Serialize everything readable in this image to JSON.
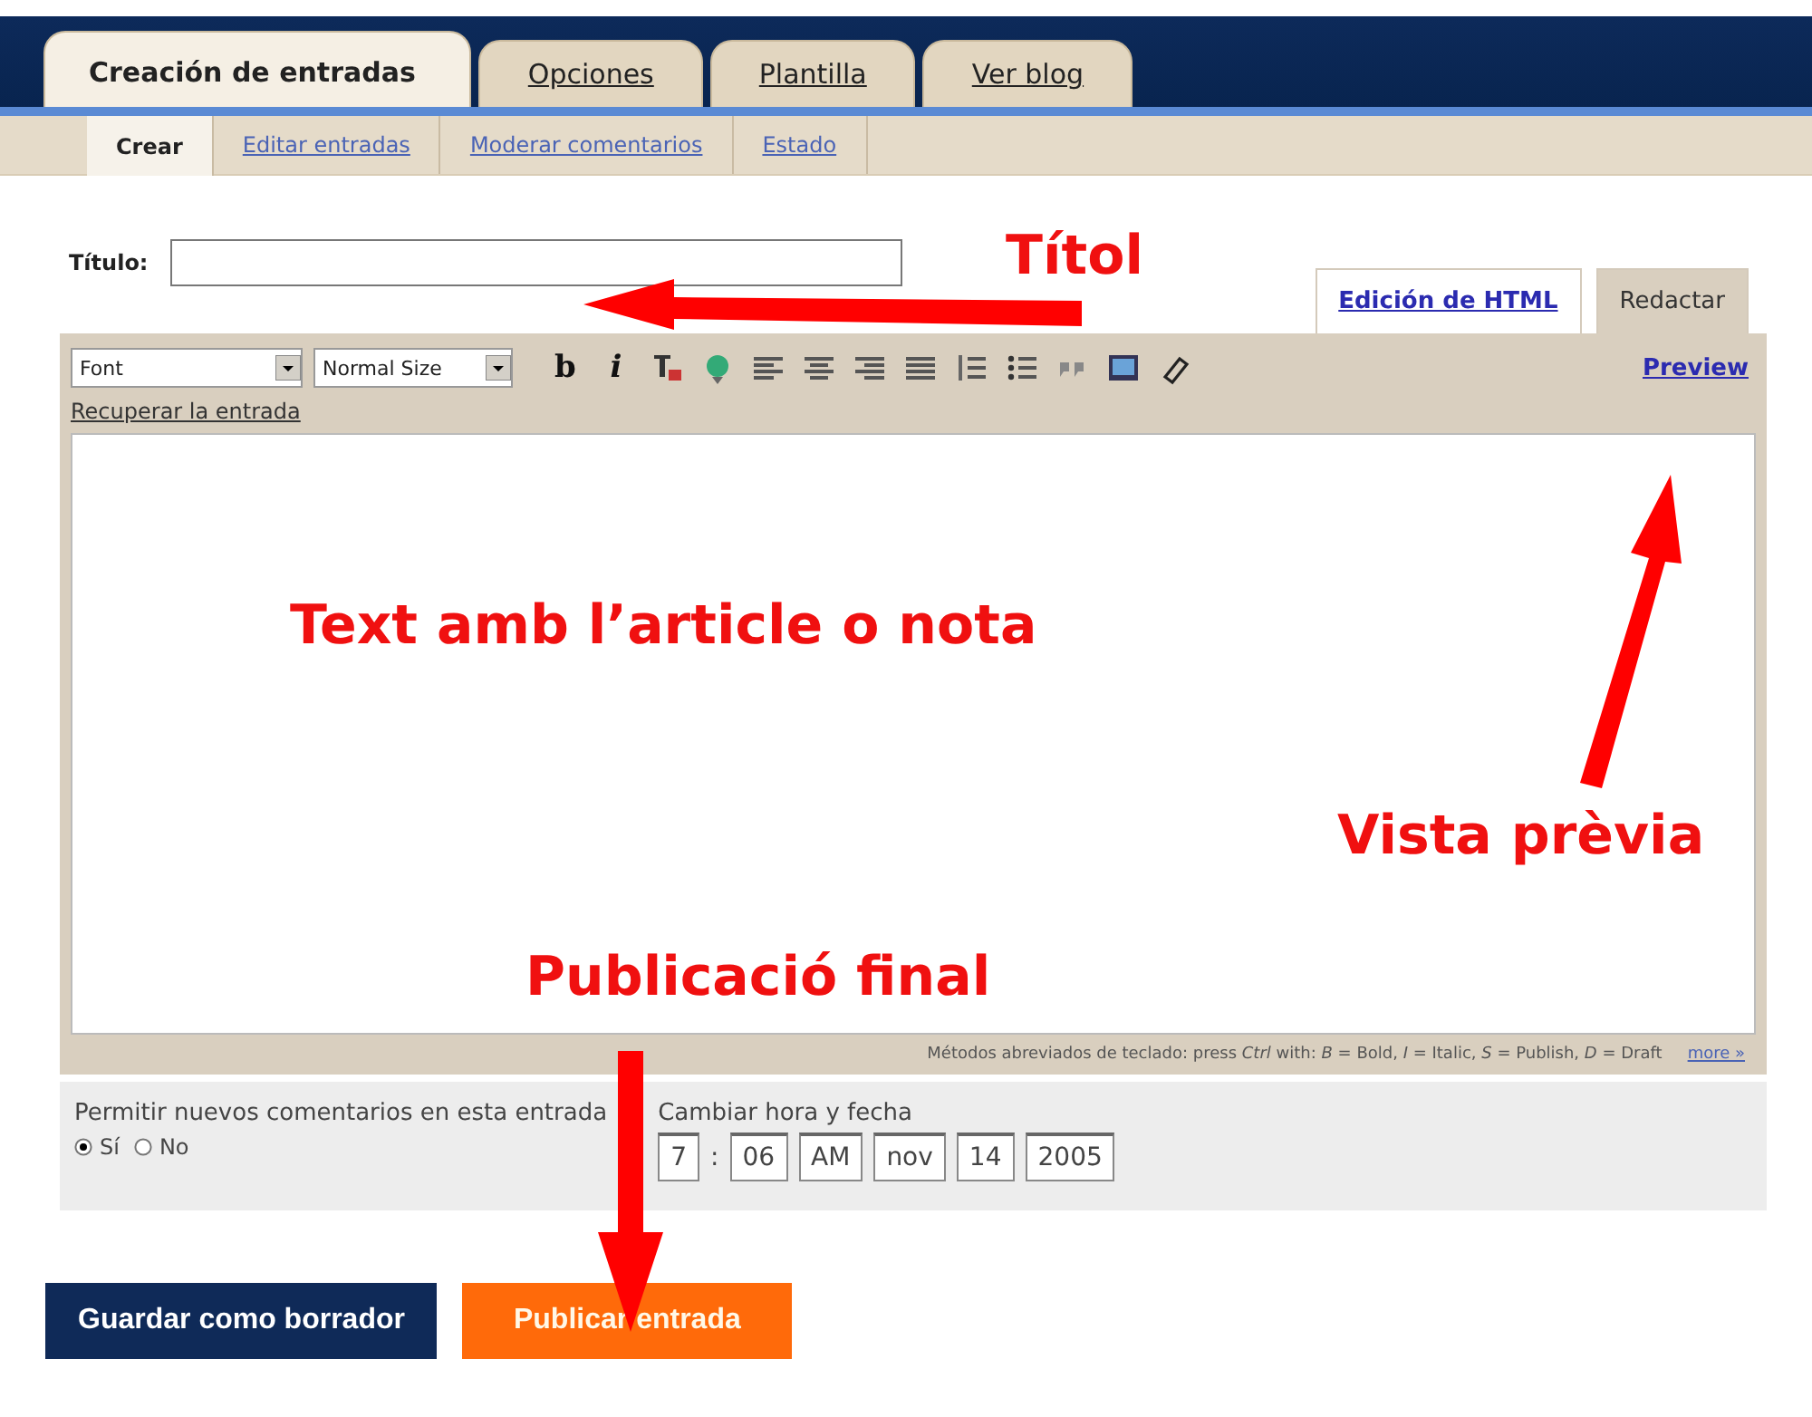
{
  "tabs": [
    {
      "label": "Creación de entradas",
      "selected": true
    },
    {
      "label": "Opciones",
      "selected": false
    },
    {
      "label": "Plantilla",
      "selected": false
    },
    {
      "label": "Ver blog",
      "selected": false
    }
  ],
  "subtabs": [
    {
      "label": "Crear",
      "selected": true
    },
    {
      "label": "Editar entradas",
      "selected": false
    },
    {
      "label": "Moderar comentarios",
      "selected": false
    },
    {
      "label": "Estado",
      "selected": false
    }
  ],
  "title_field": {
    "label": "Título:"
  },
  "editor_modes": [
    {
      "label": "Edición de HTML",
      "selected": false
    },
    {
      "label": "Redactar",
      "selected": true
    }
  ],
  "toolbar": {
    "font_select": "Font",
    "size_select": "Normal Size",
    "tools": [
      {
        "kind": "bold",
        "label": "b"
      },
      {
        "kind": "italic",
        "label": "i"
      },
      {
        "kind": "text-color"
      },
      {
        "kind": "link"
      },
      {
        "kind": "align-left"
      },
      {
        "kind": "align-center"
      },
      {
        "kind": "align-right"
      },
      {
        "kind": "justify"
      },
      {
        "kind": "numbered-list"
      },
      {
        "kind": "bullet-list"
      },
      {
        "kind": "quote"
      },
      {
        "kind": "image"
      },
      {
        "kind": "spellcheck"
      }
    ],
    "preview_link": "Preview"
  },
  "recover_link": "Recuperar la entrada",
  "shortcuts": {
    "text": "Métodos abreviados de teclado: press *Ctrl* with: *B* = Bold, *I* = Italic, *S* = Publish, *D* = Draft",
    "more_link": "more »"
  },
  "comments": {
    "label": "Permitir nuevos comentarios en esta entrada",
    "options": [
      {
        "label": "Sí",
        "selected": true
      },
      {
        "label": "No",
        "selected": false
      }
    ]
  },
  "datetime": {
    "label": "Cambiar hora y fecha",
    "selects": [
      "7",
      "06",
      "AM",
      "nov",
      "14",
      "2005"
    ],
    "separator": ":"
  },
  "buttons": [
    {
      "label": "Guardar como borrador",
      "kind": "draft"
    },
    {
      "label": "Publicar entrada",
      "kind": "publish"
    }
  ],
  "annotations": [
    {
      "text": "Títol"
    },
    {
      "text": "Text amb l’article o nota"
    },
    {
      "text": "Vista prèvia"
    },
    {
      "text": "Publicació final"
    }
  ]
}
